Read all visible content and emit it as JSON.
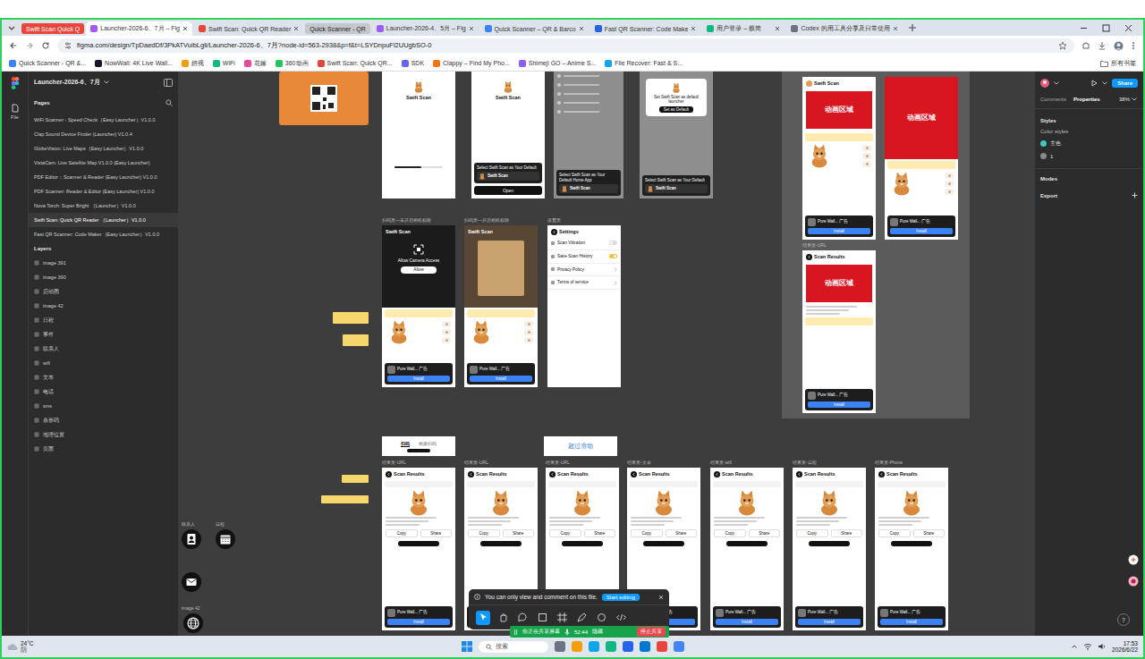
{
  "browser": {
    "tab_groups": [
      {
        "label": "Swift Scan Quick Q",
        "color": "#e8453c"
      },
      {
        "label": "Quick Scanner - QR",
        "color": "#c4c7cc"
      }
    ],
    "tabs": [
      {
        "label": "Launcher-2026-6、7月 – Fig",
        "selected": true
      },
      {
        "label": "Swift Scan: Quick QR Reader",
        "selected": false
      },
      {
        "label": "Launcher-2026-4、5月 – Fig",
        "selected": false
      },
      {
        "label": "Quick Scanner – QR & Barco",
        "selected": false
      },
      {
        "label": "Fast QR Scanner: Code Make",
        "selected": false
      },
      {
        "label": "用户登录 – 极简",
        "selected": false
      },
      {
        "label": "Codex 的用工具分享及日常使用",
        "selected": false
      }
    ],
    "url": "figma.com/design/TpDaedDf/3PkATVuibLgli/Launcher-2026-6、7月?node-id=563-2938&p=f&t=LSYDnpuFl2UUgbSO-0",
    "bookmarks": [
      "Quick Scanner - QR &...",
      "NowWall: 4K Live Wall...",
      "妞视",
      "WiFi",
      "花嫁",
      "360动画",
      "Swift Scan: Quick QR...",
      "SDK",
      "Clappy – Find My Pho...",
      "Shimeji GO – Anime S...",
      "File Recover: Fast & S..."
    ],
    "all_bookmarks": "所有书签"
  },
  "figma": {
    "rail": {
      "file_label": "File"
    },
    "file_title": "Launcher-2026-6、7月",
    "pages_heading": "Pages",
    "pages": [
      {
        "label": "WiFi Scanner - Speed Check（Easy Launcher）V1.0.0",
        "selected": false
      },
      {
        "label": "Clap Sound Device Finder (Launcher) V1.0.4",
        "selected": false
      },
      {
        "label": "GlobeVision: Live Maps（Easy Launcher）V1.0.0",
        "selected": false
      },
      {
        "label": "VistaCam: Live Satellite Map V1.0.0 (Easy Launcher)",
        "selected": false
      },
      {
        "label": "PDF Editor：Scanner & Reader (Easy Launcher) V1.0.0",
        "selected": false
      },
      {
        "label": "PDF Scanner: Reader & Editor (Easy Launcher) V1.0.0",
        "selected": false
      },
      {
        "label": "Nova Torch: Super Bright （Launcher）V1.0.0",
        "selected": false
      },
      {
        "label": "Swift Scan: Quick QR Reader （Launcher）V1.0.0",
        "selected": true
      },
      {
        "label": "Fast QR Scanner: Code Maker（Easy Launcher）V1.0.0",
        "selected": false
      }
    ],
    "layers_heading": "Layers",
    "layers": [
      "image 391",
      "image 390",
      "启动图",
      "image 42",
      "日程",
      "事件",
      "联系人",
      "wifi",
      "文本",
      "电话",
      "sms",
      "条形码",
      "地理位置",
      "页面"
    ],
    "canvas": {
      "ad": {
        "name": "Pure Wall... 广告",
        "button": "Install"
      },
      "frames": [
        {
          "kind": "splash",
          "title": "Swift Scan",
          "level": 0.55
        },
        {
          "kind": "launcher",
          "title": "Swift Scan",
          "sheet_text": "Select Swift Scan as Your Default",
          "app": "Swift Scan",
          "button": "Open"
        },
        {
          "kind": "dimmed",
          "sheet_text": "Select Swift Scan as Your Default Home App",
          "app": "Swift Scan"
        },
        {
          "kind": "dialog",
          "dialog_text": "Set Swift Scan as default launcher",
          "dialog_button": "Set as Default",
          "sheet_text": "Select Swift Scan as Your Default",
          "app": "Swift Scan"
        },
        {
          "kind": "scan",
          "label": "扫码页—未开启相机权限",
          "title": "Swift Scan",
          "prompt": "Allow Camera Access",
          "allow": "Allow"
        },
        {
          "kind": "camera",
          "label": "扫码页—开启相机权限",
          "title": "Swift Scan"
        },
        {
          "kind": "settings",
          "label": "设置页",
          "title": "Settings",
          "items": [
            {
              "label": "Scan Vibration",
              "kind": "toggle",
              "on": false
            },
            {
              "label": "Save Scan History",
              "kind": "toggle",
              "on": true
            },
            {
              "label": "Privacy Policy",
              "kind": "link"
            },
            {
              "label": "Terms of service",
              "kind": "link"
            }
          ]
        },
        {
          "kind": "anim",
          "title": "Swift Scan",
          "anim": "动画区域"
        },
        {
          "kind": "anim-full",
          "anim": "动画区域"
        },
        {
          "kind": "anim-result",
          "label": "结果页-URL",
          "title": "Scan Results",
          "anim": "动画区域"
        },
        {
          "kind": "result",
          "label": "结果页-URL",
          "title": "Scan Results",
          "actions": [
            "Copy",
            "Share"
          ]
        },
        {
          "kind": "result",
          "label": "结果页-URL",
          "title": "Scan Results",
          "actions": [
            "Copy",
            "Share"
          ]
        },
        {
          "kind": "result",
          "label": "结果页-URL",
          "title": "Scan Results",
          "actions": [
            "Copy",
            "Share"
          ]
        },
        {
          "kind": "result",
          "label": "结果页-文本",
          "title": "Scan Results",
          "actions": [
            "Copy",
            "Share"
          ]
        },
        {
          "kind": "result",
          "label": "结果页-wifi",
          "title": "Scan Results",
          "actions": [
            "Copy",
            "Share"
          ]
        },
        {
          "kind": "result",
          "label": "结果页-日程",
          "title": "Scan Results",
          "actions": [
            "Copy",
            "Share"
          ]
        },
        {
          "kind": "result",
          "label": "结果页-Phone",
          "title": "Scan Results",
          "actions": [
            "Copy",
            "Share"
          ]
        }
      ],
      "tab_switch": [
        {
          "label": "扫码",
          "selected": true
        },
        {
          "label": "相册扫码",
          "selected": false
        }
      ],
      "swipe_note": "超过滑动",
      "shortcut_labels": [
        "联系人",
        "日程",
        "image 42"
      ]
    },
    "right_panel": {
      "share": "Share",
      "zoom": "38%",
      "tabs": [
        {
          "label": "Comments",
          "selected": false
        },
        {
          "label": "Properties",
          "selected": true
        }
      ],
      "styles_heading": "Styles",
      "color_styles_heading": "Color styles",
      "color_styles": [
        {
          "label": "主色",
          "color": "#3ec9c0"
        },
        {
          "label": "1",
          "color": "#8a8a8a"
        }
      ],
      "modes": "Modes",
      "export": "Export",
      "help": "?"
    },
    "notice": {
      "text": "You can only view and comment on this file.",
      "button": "Start editing"
    },
    "tools": [
      {
        "selected": true
      },
      {
        "selected": false
      },
      {
        "selected": false
      },
      {
        "selected": false
      },
      {
        "selected": false
      },
      {
        "selected": false
      },
      {
        "selected": false
      },
      {
        "selected": false
      }
    ]
  },
  "share_bar": {
    "text": "你正在共享屏幕",
    "timer": "52:44",
    "hide": "隐藏",
    "stop": "停止共享"
  },
  "taskbar": {
    "temperature": "24°C",
    "weather": "阴",
    "search": "搜索",
    "time": "17:53",
    "date": "2026/6/22"
  }
}
